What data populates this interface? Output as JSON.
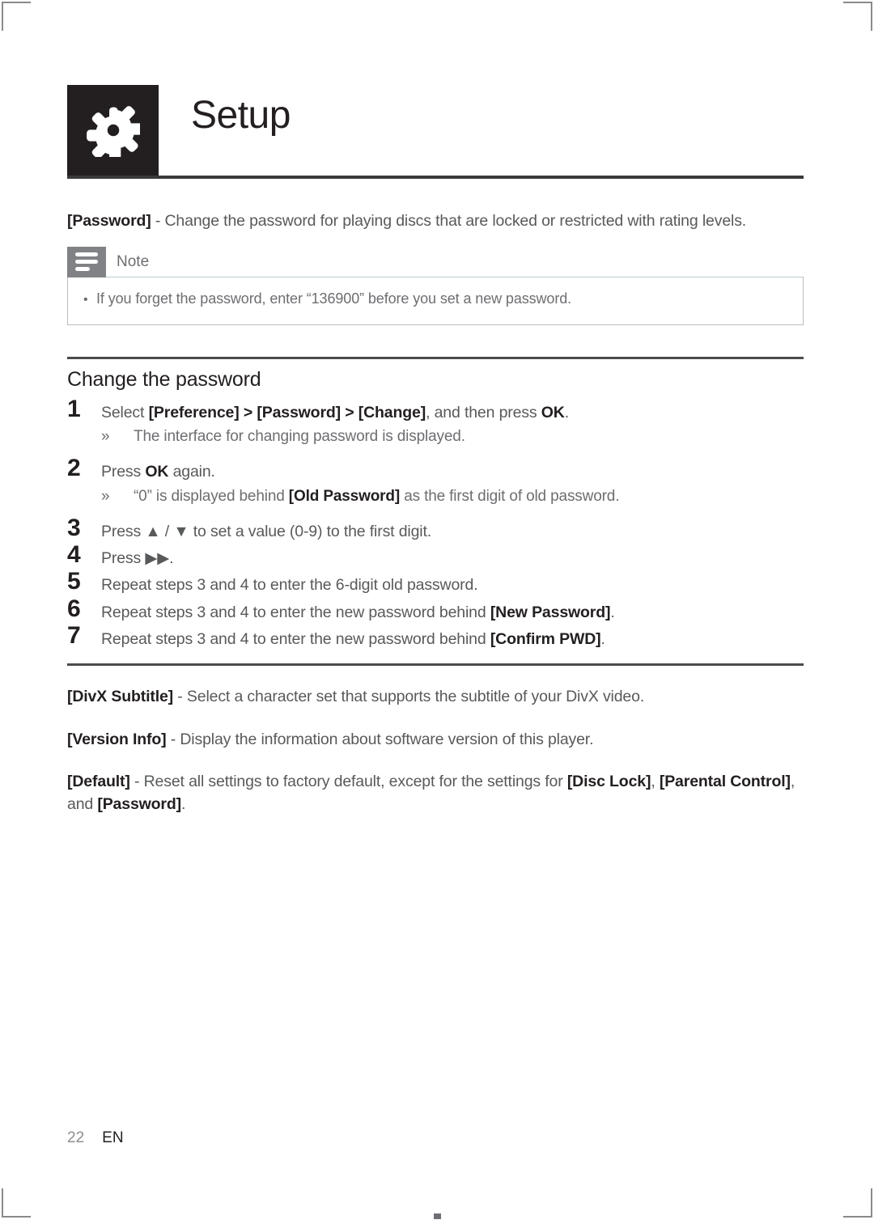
{
  "header": {
    "title": "Setup",
    "icon": "gear-icon"
  },
  "intro": {
    "term": "[Password]",
    "dash": " - ",
    "text": "Change the password for playing discs that are locked or restricted with rating levels."
  },
  "note": {
    "icon": "note-lines-icon",
    "label": "Note",
    "items": [
      "If you forget the password, enter “136900” before you set a new password."
    ],
    "bullet": "•"
  },
  "section": {
    "heading": "Change the password"
  },
  "steps": [
    {
      "num": "1",
      "parts": [
        {
          "t": "Select ",
          "b": false
        },
        {
          "t": "[Preference]",
          "b": true
        },
        {
          "t": " > ",
          "b": true
        },
        {
          "t": "[Password]",
          "b": true
        },
        {
          "t": " > ",
          "b": true
        },
        {
          "t": "[Change]",
          "b": true
        },
        {
          "t": ", and then press ",
          "b": false
        },
        {
          "t": "OK",
          "b": true
        },
        {
          "t": ".",
          "b": false
        }
      ],
      "sub": {
        "marker": "»",
        "parts": [
          {
            "t": "The interface for changing password is displayed.",
            "b": false
          }
        ]
      }
    },
    {
      "num": "2",
      "parts": [
        {
          "t": "Press ",
          "b": false
        },
        {
          "t": "OK",
          "b": true
        },
        {
          "t": " again.",
          "b": false
        }
      ],
      "sub": {
        "marker": "»",
        "parts": [
          {
            "t": "“0” is displayed behind ",
            "b": false
          },
          {
            "t": "[Old Password]",
            "b": true
          },
          {
            "t": " as the first digit of old password.",
            "b": false
          }
        ]
      }
    },
    {
      "num": "3",
      "parts": [
        {
          "t": "Press ",
          "b": false
        },
        {
          "t": "▲",
          "b": false
        },
        {
          "t": " / ",
          "b": false
        },
        {
          "t": "▼",
          "b": false
        },
        {
          "t": " to set a value (0-9) to the first digit.",
          "b": false
        }
      ],
      "sub": null
    },
    {
      "num": "4",
      "parts": [
        {
          "t": "Press ",
          "b": false
        },
        {
          "t": "▶▶",
          "b": false
        },
        {
          "t": ".",
          "b": false
        }
      ],
      "sub": null
    },
    {
      "num": "5",
      "parts": [
        {
          "t": "Repeat steps 3 and 4 to enter the 6-digit old password.",
          "b": false
        }
      ],
      "sub": null
    },
    {
      "num": "6",
      "parts": [
        {
          "t": "Repeat steps 3 and 4 to enter the new password behind ",
          "b": false
        },
        {
          "t": "[New Password]",
          "b": true
        },
        {
          "t": ".",
          "b": false
        }
      ],
      "sub": null
    },
    {
      "num": "7",
      "parts": [
        {
          "t": "Repeat steps 3 and 4 to enter the new password behind ",
          "b": false
        },
        {
          "t": "[Confirm PWD]",
          "b": true
        },
        {
          "t": ".",
          "b": false
        }
      ],
      "sub": null
    }
  ],
  "tail_paragraphs": [
    {
      "name": "divx-subtitle",
      "parts": [
        {
          "t": "[DivX Subtitle]",
          "b": true
        },
        {
          "t": " - Select a character set that supports the subtitle of your DivX video.",
          "b": false
        }
      ]
    },
    {
      "name": "version-info",
      "parts": [
        {
          "t": "[Version Info]",
          "b": true
        },
        {
          "t": " - Display the information about software version of this player.",
          "b": false
        }
      ]
    },
    {
      "name": "default",
      "parts": [
        {
          "t": "[Default]",
          "b": true
        },
        {
          "t": " - Reset all settings to factory default, except for the settings for ",
          "b": false
        },
        {
          "t": "[Disc Lock]",
          "b": true
        },
        {
          "t": ", ",
          "b": false
        },
        {
          "t": "[Parental Control]",
          "b": true
        },
        {
          "t": ", and ",
          "b": false
        },
        {
          "t": "[Password]",
          "b": true
        },
        {
          "t": ".",
          "b": false
        }
      ]
    }
  ],
  "footer": {
    "page_number": "22",
    "language": "EN"
  },
  "colors": {
    "ink": "#231f20",
    "body": "#58595b",
    "muted": "#6d6e71",
    "note_icon_bg": "#808286",
    "rule": "#4b4b4b"
  }
}
